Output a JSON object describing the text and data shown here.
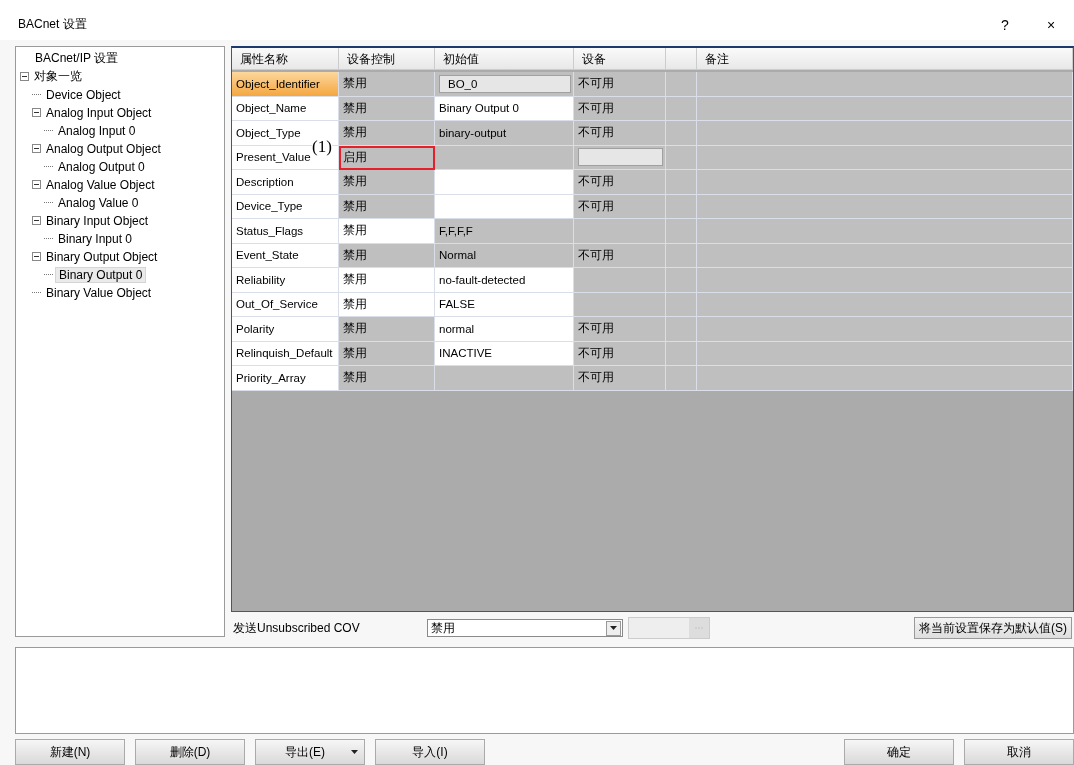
{
  "window": {
    "title": "BACnet 设置",
    "help": "?",
    "close": "×"
  },
  "tree": [
    {
      "label": "BACnet/IP 设置",
      "selected": false
    },
    {
      "label": "对象一览",
      "selected": false,
      "expanded": true,
      "children": [
        {
          "label": "Device Object",
          "selected": false
        },
        {
          "label": "Analog Input Object",
          "selected": false,
          "expanded": true,
          "children": [
            {
              "label": "Analog Input 0",
              "selected": false
            }
          ]
        },
        {
          "label": "Analog Output Object",
          "selected": false,
          "expanded": true,
          "children": [
            {
              "label": "Analog Output 0",
              "selected": false
            }
          ]
        },
        {
          "label": "Analog Value Object",
          "selected": false,
          "expanded": true,
          "children": [
            {
              "label": "Analog Value 0",
              "selected": false
            }
          ]
        },
        {
          "label": "Binary Input Object",
          "selected": false,
          "expanded": true,
          "children": [
            {
              "label": "Binary Input 0",
              "selected": false
            }
          ]
        },
        {
          "label": "Binary Output Object",
          "selected": false,
          "expanded": true,
          "children": [
            {
              "label": "Binary Output 0",
              "selected": true
            }
          ]
        },
        {
          "label": "Binary Value Object",
          "selected": false
        }
      ]
    }
  ],
  "table": {
    "columns": [
      "属性名称",
      "设备控制",
      "初始值",
      "设备",
      "",
      "备注"
    ],
    "rows": [
      {
        "selected": true,
        "cells": [
          {
            "text": "Object_Identifier",
            "kind": "white"
          },
          {
            "text": "禁用",
            "kind": "gray"
          },
          {
            "text": "BO_0",
            "kind": "box"
          },
          {
            "text": "不可用",
            "kind": "gray"
          }
        ]
      },
      {
        "selected": false,
        "cells": [
          {
            "text": "Object_Name",
            "kind": "white"
          },
          {
            "text": "禁用",
            "kind": "gray"
          },
          {
            "text": "Binary Output 0",
            "kind": "white"
          },
          {
            "text": "不可用",
            "kind": "gray"
          }
        ]
      },
      {
        "selected": false,
        "cells": [
          {
            "text": "Object_Type",
            "kind": "white"
          },
          {
            "text": "禁用",
            "kind": "gray"
          },
          {
            "text": "binary-output",
            "kind": "gray"
          },
          {
            "text": "不可用",
            "kind": "gray"
          }
        ]
      },
      {
        "selected": false,
        "cells": [
          {
            "text": "Present_Value",
            "kind": "white"
          },
          {
            "text": "启用",
            "kind": "gray",
            "callout": "(1)"
          },
          {
            "kind": "gray"
          },
          {
            "kind": "box"
          }
        ]
      },
      {
        "selected": false,
        "cells": [
          {
            "text": "Description",
            "kind": "white"
          },
          {
            "text": "禁用",
            "kind": "gray"
          },
          {
            "kind": "white"
          },
          {
            "text": "不可用",
            "kind": "gray"
          }
        ]
      },
      {
        "selected": false,
        "cells": [
          {
            "text": "Device_Type",
            "kind": "white"
          },
          {
            "text": "禁用",
            "kind": "gray"
          },
          {
            "kind": "white"
          },
          {
            "text": "不可用",
            "kind": "gray"
          }
        ]
      },
      {
        "selected": false,
        "cells": [
          {
            "text": "Status_Flags",
            "kind": "white"
          },
          {
            "text": "禁用",
            "kind": "white"
          },
          {
            "text": "F,F,F,F",
            "kind": "gray"
          },
          {
            "kind": "gray"
          }
        ]
      },
      {
        "selected": false,
        "cells": [
          {
            "text": "Event_State",
            "kind": "white"
          },
          {
            "text": "禁用",
            "kind": "gray"
          },
          {
            "text": "Normal",
            "kind": "gray"
          },
          {
            "text": "不可用",
            "kind": "gray"
          }
        ]
      },
      {
        "selected": false,
        "cells": [
          {
            "text": "Reliability",
            "kind": "white"
          },
          {
            "text": "禁用",
            "kind": "white"
          },
          {
            "text": "no-fault-detected",
            "kind": "white"
          },
          {
            "kind": "gray"
          }
        ]
      },
      {
        "selected": false,
        "cells": [
          {
            "text": "Out_Of_Service",
            "kind": "white"
          },
          {
            "text": "禁用",
            "kind": "white"
          },
          {
            "text": "FALSE",
            "kind": "white"
          },
          {
            "kind": "gray"
          }
        ]
      },
      {
        "selected": false,
        "cells": [
          {
            "text": "Polarity",
            "kind": "white"
          },
          {
            "text": "禁用",
            "kind": "gray"
          },
          {
            "text": "normal",
            "kind": "white"
          },
          {
            "text": "不可用",
            "kind": "gray"
          }
        ]
      },
      {
        "selected": false,
        "cells": [
          {
            "text": "Relinquish_Default",
            "kind": "white"
          },
          {
            "text": "禁用",
            "kind": "gray"
          },
          {
            "text": "INACTIVE",
            "kind": "white"
          },
          {
            "text": "不可用",
            "kind": "gray"
          }
        ]
      },
      {
        "selected": false,
        "cells": [
          {
            "text": "Priority_Array",
            "kind": "white"
          },
          {
            "text": "禁用",
            "kind": "gray"
          },
          {
            "kind": "gray"
          },
          {
            "text": "不可用",
            "kind": "gray"
          }
        ]
      }
    ]
  },
  "cov": {
    "label": "发送Unsubscribed COV",
    "value": "禁用",
    "extra_disabled": true,
    "save_button": "将当前设置保存为默认值(S)"
  },
  "actions_left": [
    {
      "label": "新建(N)",
      "kind": "button"
    },
    {
      "label": "删除(D)",
      "kind": "button"
    },
    {
      "label": "导出(E)",
      "kind": "split"
    },
    {
      "label": "导入(I)",
      "kind": "button"
    }
  ],
  "actions_right": [
    {
      "label": "确定"
    },
    {
      "label": "取消"
    }
  ]
}
